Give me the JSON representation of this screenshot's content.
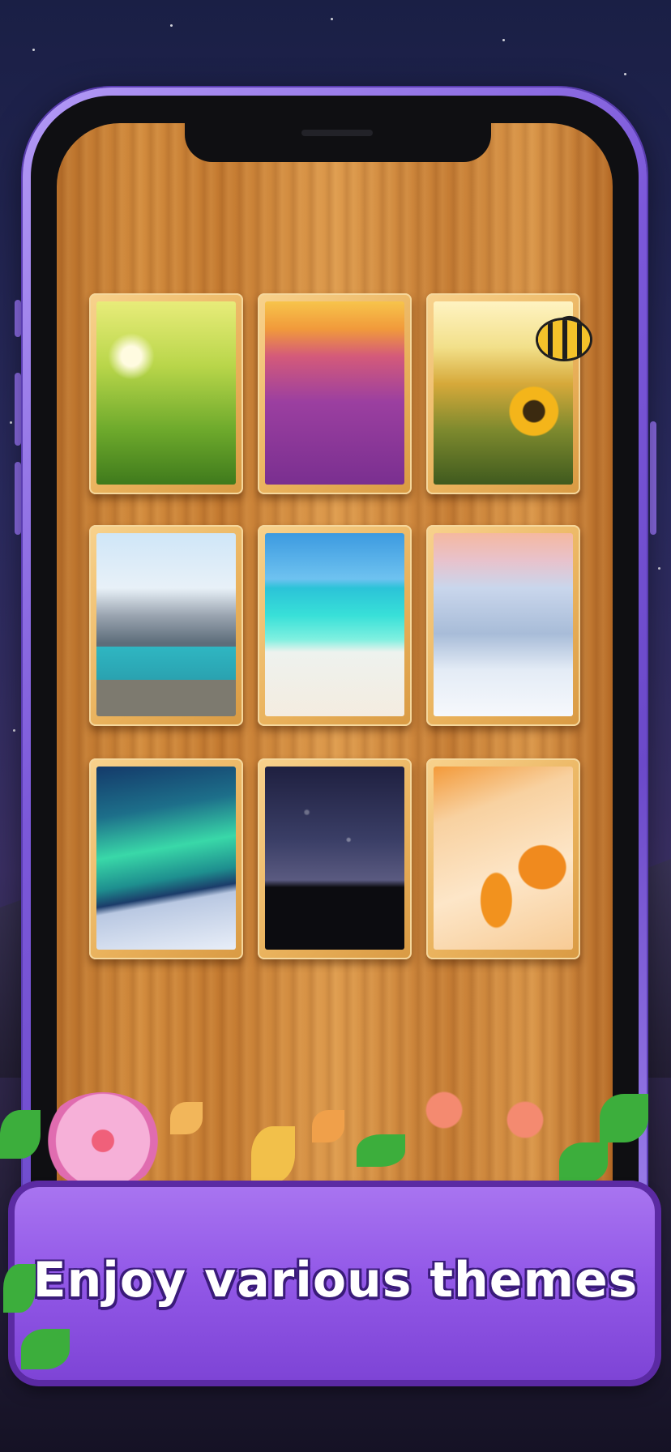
{
  "banner": {
    "text": "Enjoy various themes"
  },
  "themes": [
    {
      "name": "wheat-field-theme"
    },
    {
      "name": "lavender-field-theme"
    },
    {
      "name": "sunflower-field-theme"
    },
    {
      "name": "mountain-lake-theme"
    },
    {
      "name": "tropical-beach-theme"
    },
    {
      "name": "snowy-forest-theme"
    },
    {
      "name": "aurora-theme"
    },
    {
      "name": "starry-night-theme"
    },
    {
      "name": "jellyfish-theme"
    }
  ],
  "colors": {
    "banner": "#9359e8",
    "phone_frame": "#7b58d9",
    "wood": "#d18a3c"
  }
}
